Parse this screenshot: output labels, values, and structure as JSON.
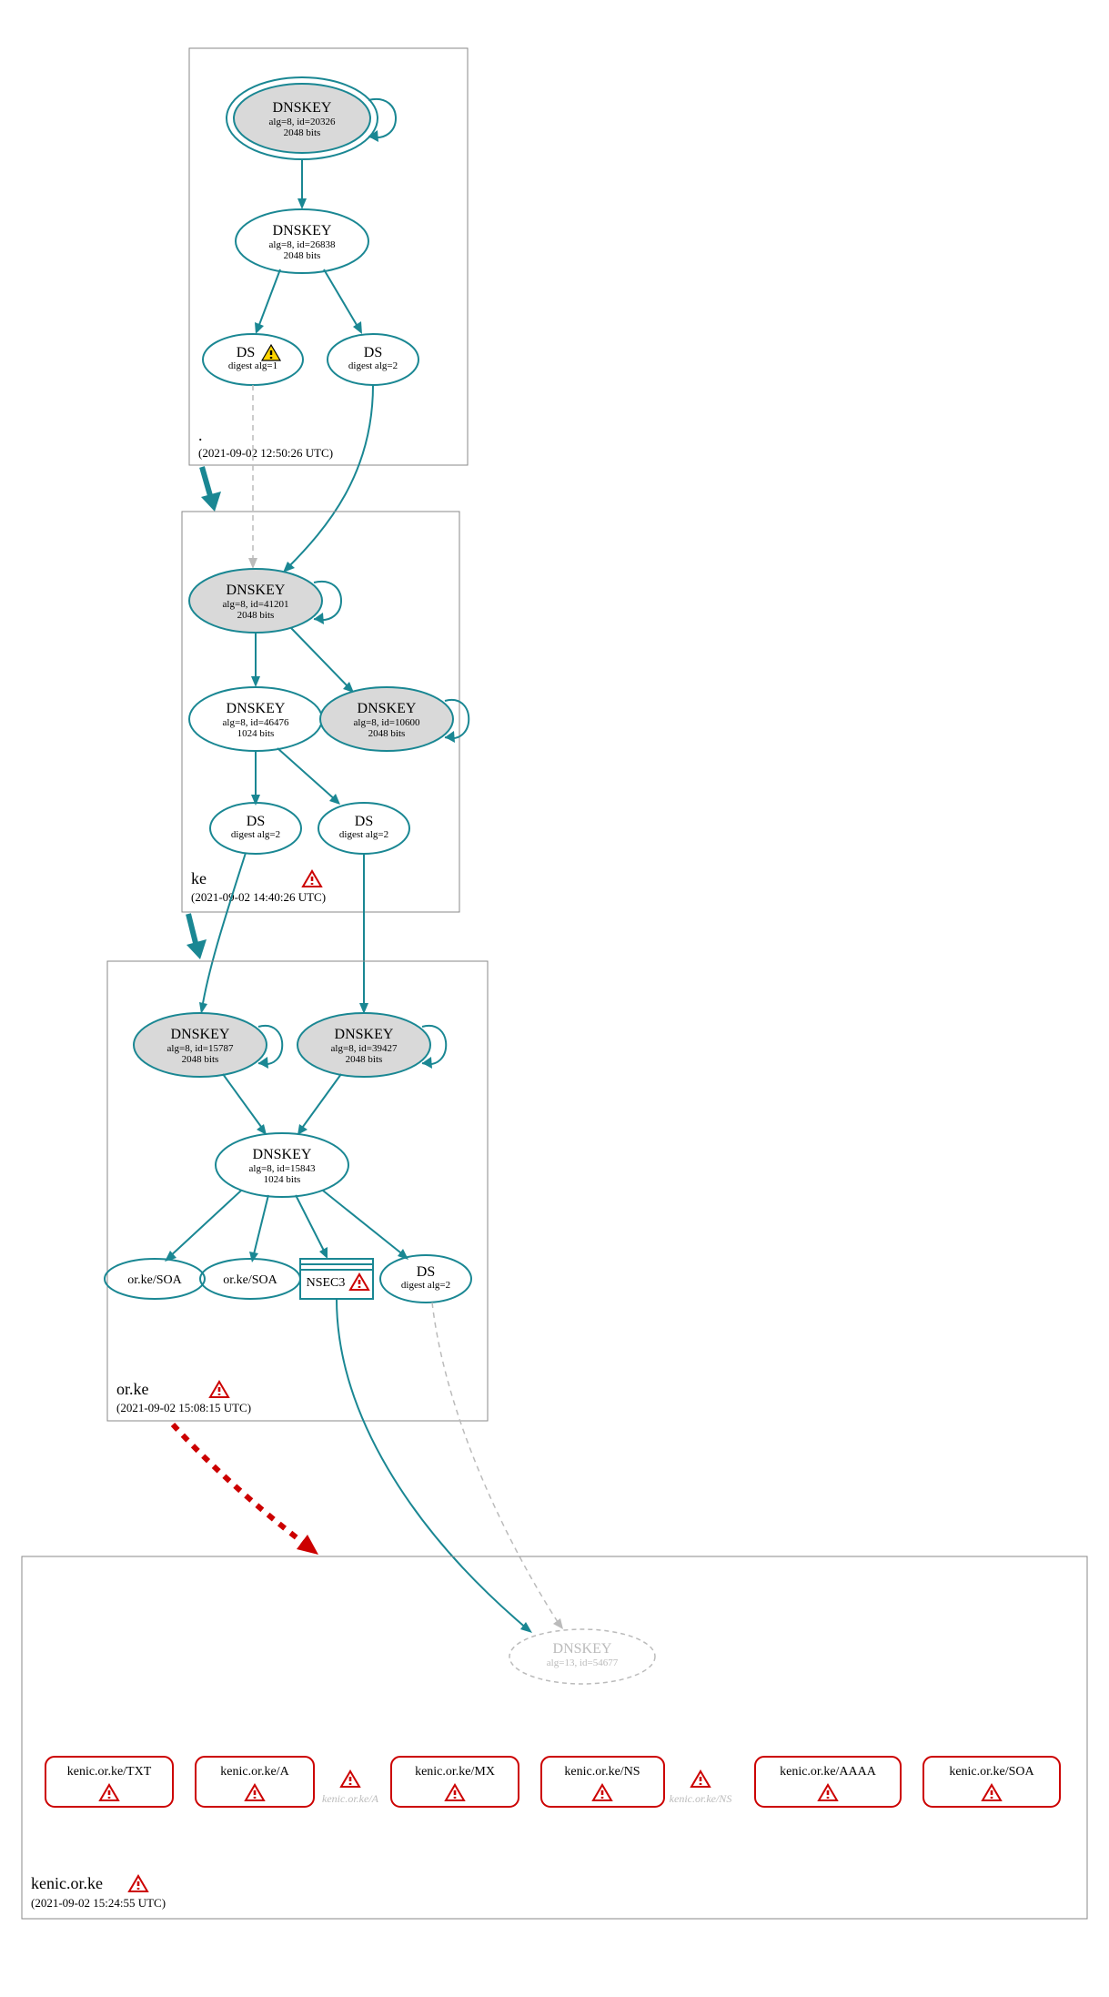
{
  "colors": {
    "teal": "#1a8793",
    "red": "#cc0000",
    "grey_fill": "#d9d9d9",
    "grey_stroke": "#bbbbbb",
    "box_stroke": "#888888"
  },
  "zones": {
    "root": {
      "label": ".",
      "timestamp": "(2021-09-02 12:50:26 UTC)",
      "nodes": {
        "ksk": {
          "title": "DNSKEY",
          "sub1": "alg=8, id=20326",
          "sub2": "2048 bits"
        },
        "zsk": {
          "title": "DNSKEY",
          "sub1": "alg=8, id=26838",
          "sub2": "2048 bits"
        },
        "ds1": {
          "title": "DS",
          "sub1": "digest alg=1"
        },
        "ds2": {
          "title": "DS",
          "sub1": "digest alg=2"
        }
      }
    },
    "ke": {
      "label": "ke",
      "timestamp": "(2021-09-02 14:40:26 UTC)",
      "nodes": {
        "ksk": {
          "title": "DNSKEY",
          "sub1": "alg=8, id=41201",
          "sub2": "2048 bits"
        },
        "zsk": {
          "title": "DNSKEY",
          "sub1": "alg=8, id=46476",
          "sub2": "1024 bits"
        },
        "ksk2": {
          "title": "DNSKEY",
          "sub1": "alg=8, id=10600",
          "sub2": "2048 bits"
        },
        "ds1": {
          "title": "DS",
          "sub1": "digest alg=2"
        },
        "ds2": {
          "title": "DS",
          "sub1": "digest alg=2"
        }
      }
    },
    "orke": {
      "label": "or.ke",
      "timestamp": "(2021-09-02 15:08:15 UTC)",
      "nodes": {
        "ksk1": {
          "title": "DNSKEY",
          "sub1": "alg=8, id=15787",
          "sub2": "2048 bits"
        },
        "ksk2": {
          "title": "DNSKEY",
          "sub1": "alg=8, id=39427",
          "sub2": "2048 bits"
        },
        "zsk": {
          "title": "DNSKEY",
          "sub1": "alg=8, id=15843",
          "sub2": "1024 bits"
        },
        "soa1": {
          "title": "or.ke/SOA"
        },
        "soa2": {
          "title": "or.ke/SOA"
        },
        "nsec3": {
          "title": "NSEC3"
        },
        "ds": {
          "title": "DS",
          "sub1": "digest alg=2"
        }
      }
    },
    "kenic": {
      "label": "kenic.or.ke",
      "timestamp": "(2021-09-02 15:24:55 UTC)",
      "nodes": {
        "dnskey": {
          "title": "DNSKEY",
          "sub1": "alg=13, id=54677"
        },
        "txt": {
          "title": "kenic.or.ke/TXT"
        },
        "a": {
          "title": "kenic.or.ke/A"
        },
        "mx": {
          "title": "kenic.or.ke/MX"
        },
        "ns": {
          "title": "kenic.or.ke/NS"
        },
        "aaaa": {
          "title": "kenic.or.ke/AAAA"
        },
        "soa": {
          "title": "kenic.or.ke/SOA"
        }
      },
      "ghosts": {
        "a": "kenic.or.ke/A",
        "ns": "kenic.or.ke/NS"
      }
    }
  }
}
